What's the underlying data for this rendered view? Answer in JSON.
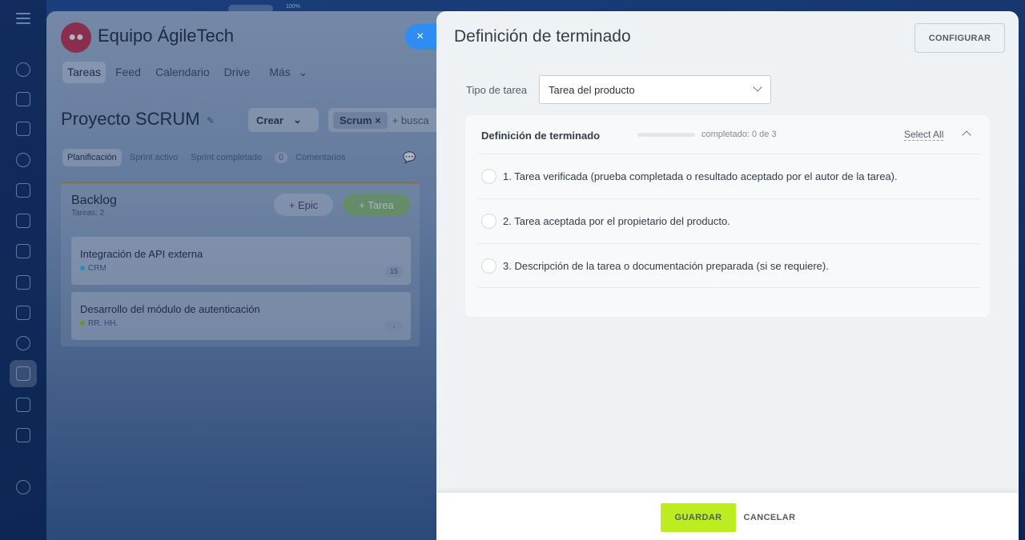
{
  "topbar": {
    "zoom": "100%"
  },
  "workspace": {
    "group_name": "Equipo ÁgileTech",
    "nav": [
      "Tareas",
      "Feed",
      "Calendario",
      "Drive",
      "Más"
    ],
    "project_title": "Proyecto SCRUM",
    "create_label": "Crear",
    "search_chip": "Scrum",
    "search_placeholder": "+ busca",
    "tabs": [
      "Planificación",
      "Sprint activo",
      "Sprint completado"
    ],
    "comments_count": "0",
    "comments_label": "Comentarios",
    "backlog_title": "Backlog",
    "backlog_count": "Tareas: 2",
    "epic_label": "+ Epic",
    "task_label": "+ Tarea",
    "cards": [
      {
        "title": "Integración de API externa",
        "tag": "CRM",
        "tag_color": "#2fc6f6",
        "points": "15"
      },
      {
        "title": "Desarrollo del módulo de autenticación",
        "tag": "RR. HH.",
        "tag_color": "#9dcf00",
        "points": "-"
      }
    ]
  },
  "panel": {
    "close_label": "×",
    "title": "Definición de terminado",
    "configure_label": "CONFIGURAR",
    "task_type_label": "Tipo de tarea",
    "task_type_value": "Tarea del producto",
    "dod": {
      "heading": "Definición de terminado",
      "progress_text": "completado: 0 de 3",
      "progress_fraction": 0,
      "select_all": "Select All",
      "items": [
        "1. Tarea verificada (prueba completada o resultado aceptado por el autor de la tarea).",
        "2. Tarea aceptada por el propietario del producto.",
        "3. Descripción de la tarea o documentación preparada (si se requiere)."
      ]
    },
    "save_label": "GUARDAR",
    "cancel_label": "CANCELAR"
  },
  "colors": {
    "accent_blue": "#2f8cf3",
    "save_green": "#bbed21",
    "panel_bg": "#eef2f4"
  }
}
